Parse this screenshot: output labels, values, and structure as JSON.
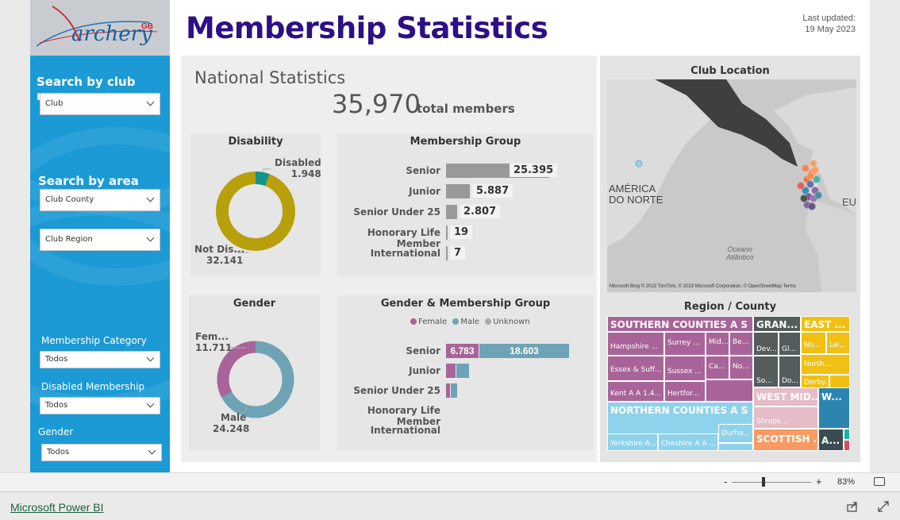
{
  "header": {
    "title": "Membership Statistics",
    "last_updated_label": "Last updated:",
    "last_updated_date": "19 May 2023"
  },
  "logo": {
    "text": "archery",
    "suffix": "GB"
  },
  "sidebar": {
    "club_heading": "Search by club name",
    "club_dropdown": "Club",
    "area_heading": "Search by area",
    "county_dropdown": "Club County",
    "region_dropdown": "Club Region",
    "filters": [
      {
        "label": "Membership Category",
        "value": "Todos"
      },
      {
        "label": "Disabled Membership",
        "value": "Todos"
      },
      {
        "label": "Gender",
        "value": "Todos"
      }
    ]
  },
  "national": {
    "title": "National Statistics",
    "total": "35,970",
    "total_label": "total members"
  },
  "disability": {
    "title": "Disability",
    "slices": [
      {
        "label": "Disabled",
        "value": "1.948",
        "num": 1948,
        "color": "#14948c"
      },
      {
        "label": "Not Dis...",
        "value": "32.141",
        "num": 32141,
        "color": "#b8a00c"
      }
    ]
  },
  "membership_group": {
    "title": "Membership Group",
    "rows": [
      {
        "label": "Senior",
        "value": "25.395",
        "num": 25395
      },
      {
        "label": "Junior",
        "value": "5.887",
        "num": 5887
      },
      {
        "label": "Senior Under 25",
        "value": "2.807",
        "num": 2807
      },
      {
        "label": "Honorary Life Member",
        "value": "19",
        "num": 19
      },
      {
        "label": "International",
        "value": "7",
        "num": 7
      }
    ],
    "color": "#999999"
  },
  "gender": {
    "title": "Gender",
    "slices": [
      {
        "label": "Fem...",
        "value": "11.711",
        "num": 11711,
        "color": "#a86498"
      },
      {
        "label": "Male",
        "value": "24.248",
        "num": 24248,
        "color": "#6ea3b5"
      }
    ]
  },
  "gender_group": {
    "title": "Gender & Membership Group",
    "legend": [
      {
        "label": "Female",
        "color": "#a86498"
      },
      {
        "label": "Male",
        "color": "#6ea3b5"
      },
      {
        "label": "Unknown",
        "color": "#aaaaaa"
      }
    ],
    "rows": [
      {
        "label": "Senior",
        "female": 6783,
        "male": 18603,
        "female_label": "6.783",
        "male_label": "18.603"
      },
      {
        "label": "Junior",
        "female": 2000,
        "male": 2600,
        "female_label": "",
        "male_label": ""
      },
      {
        "label": "Senior Under 25",
        "female": 800,
        "male": 1400,
        "female_label": "",
        "male_label": ""
      },
      {
        "label": "Honorary Life Member",
        "female": 0,
        "male": 0,
        "female_label": "",
        "male_label": ""
      },
      {
        "label": "International",
        "female": 0,
        "male": 0,
        "female_label": "",
        "male_label": ""
      }
    ]
  },
  "map": {
    "title": "Club Location",
    "label_america": "AMÉRICA",
    "label_norte": "DO NORTE",
    "label_ocean1": "Oceano",
    "label_ocean2": "Atlântico",
    "label_eu": "EU",
    "attribution": "Microsoft Bing  © 2023 TomTom, © 2023 Microsoft Corporation, © OpenStreetMap  Terms"
  },
  "treemap": {
    "title": "Region / County",
    "cells": {
      "southern": "SOUTHERN COUNTIES A S",
      "hampshire": "Hampshire ...",
      "surrey": "Surrey ...",
      "mid": "Mid...",
      "be": "Be...",
      "essex": "Essex & Suff...",
      "sussex": "Sussex ...",
      "ca": "Ca...",
      "no": "No...",
      "kent": "Kent A A 1.4...",
      "hertford": "Hertfor...",
      "gran": "GRAN...",
      "dev": "Dev...",
      "gl": "Gl...",
      "so": "So...",
      "do": "Do...",
      "east": "EAST ...",
      "no2": "No...",
      "lei": "Lei...",
      "north_e": "North...",
      "derby": "Derby...",
      "northern": "NORTHERN COUNTIES A S",
      "yorkshire": "Yorkshire A...",
      "cheshire": "Cheshire A A ...",
      "durha": "Durha...",
      "westmid": "WEST MID...",
      "shrops": "Shrops...",
      "w": "W...",
      "scottish": "SCOTTISH ...",
      "a": "A..."
    }
  },
  "status": {
    "zoom": "83%",
    "minus": "-",
    "plus": "+"
  },
  "footer": {
    "link": "Microsoft Power BI"
  }
}
